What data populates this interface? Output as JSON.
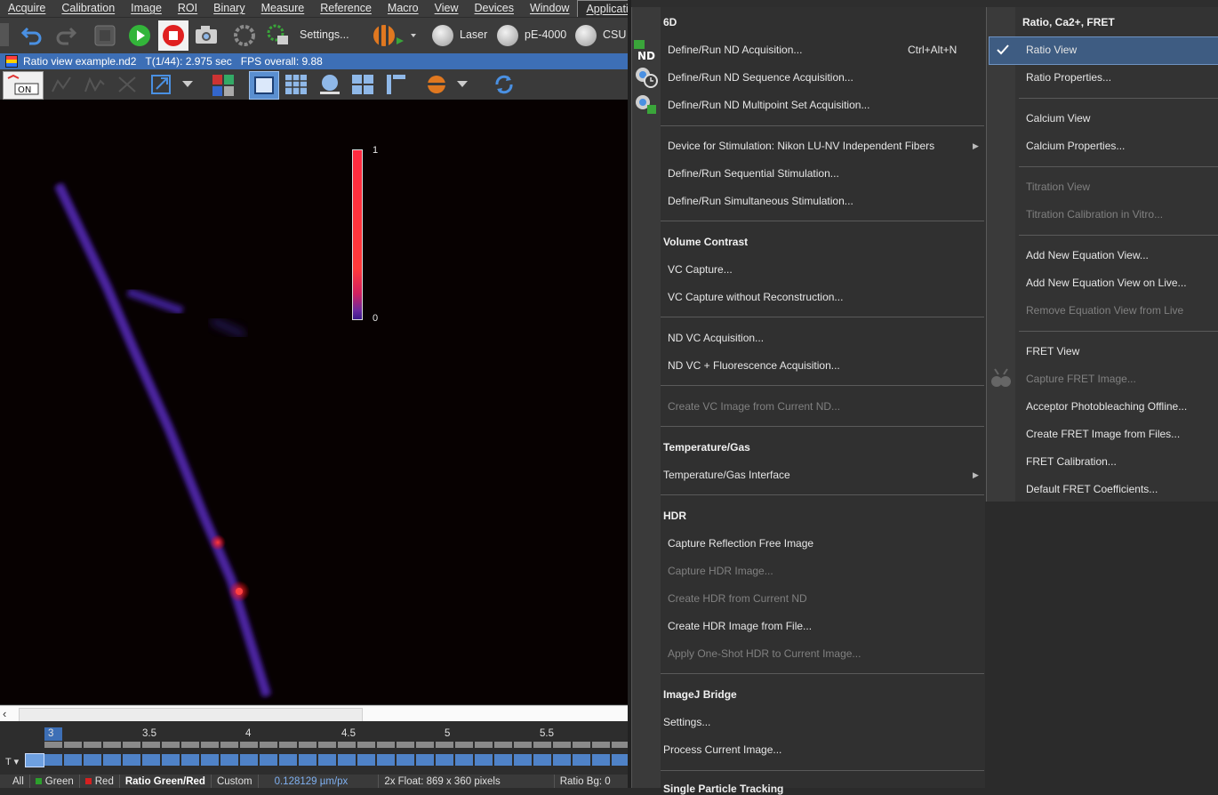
{
  "menubar": {
    "items": [
      "Acquire",
      "Calibration",
      "Image",
      "ROI",
      "Binary",
      "Measure",
      "Reference",
      "Macro",
      "View",
      "Devices",
      "Window",
      "Applications"
    ]
  },
  "toolbar": {
    "settings_label": "Settings...",
    "devices": [
      "Laser",
      "pE-4000",
      "CSU"
    ]
  },
  "image_window": {
    "title": "Ratio view example.nd2",
    "time": "T(1/44): 2.975 sec",
    "fps": "FPS overall: 9.88"
  },
  "scale": {
    "max": "1",
    "min": "0"
  },
  "timeline": {
    "ticks": [
      "3",
      "3.5",
      "4",
      "4.5",
      "5",
      "5.5"
    ],
    "axis_label": "T"
  },
  "statusbar": {
    "all": "All",
    "green": "Green",
    "red": "Red",
    "ratio": "Ratio Green/Red",
    "custom": "Custom",
    "calibration": "0.128129 µm/px",
    "format": "2x Float: 869 x 360 pixels",
    "ratio_bg": "Ratio Bg: 0"
  },
  "apps_menu": {
    "sections": {
      "s6d": "6D",
      "vc": "Volume Contrast",
      "temp": "Temperature/Gas",
      "hdr": "HDR",
      "imagej": "ImageJ Bridge",
      "spt": "Single Particle Tracking"
    },
    "items": {
      "nd_acq": "Define/Run ND Acquisition...",
      "nd_acq_shortcut": "Ctrl+Alt+N",
      "nd_seq": "Define/Run ND Sequence Acquisition...",
      "nd_multi": "Define/Run ND Multipoint Set Acquisition...",
      "stim_device": "Device for Stimulation: Nikon LU-NV Independent Fibers",
      "seq_stim": "Define/Run Sequential Stimulation...",
      "sim_stim": "Define/Run Simultaneous Stimulation...",
      "vc_capture": "VC Capture...",
      "vc_capture_norecon": "VC Capture without Reconstruction...",
      "nd_vc": "ND VC Acquisition...",
      "nd_vc_fluo": "ND VC + Fluorescence Acquisition...",
      "vc_from_nd": "Create VC Image from Current ND...",
      "temp_iface": "Temperature/Gas Interface",
      "refl_free": "Capture Reflection Free Image",
      "cap_hdr": "Capture HDR Image...",
      "hdr_from_nd": "Create HDR from Current ND",
      "hdr_from_file": "Create HDR Image from File...",
      "oneshot_hdr": "Apply One-Shot HDR to Current Image...",
      "ij_settings": "Settings...",
      "ij_process": "Process Current Image..."
    }
  },
  "sub_menu": {
    "header": "Ratio, Ca2+, FRET",
    "items": {
      "ratio_view": "Ratio View",
      "ratio_props": "Ratio Properties...",
      "calcium_view": "Calcium View",
      "calcium_props": "Calcium Properties...",
      "titration_view": "Titration View",
      "titration_calib": "Titration Calibration in Vitro...",
      "add_eq": "Add New Equation View...",
      "add_eq_live": "Add New Equation View on Live...",
      "remove_eq": "Remove Equation View from Live",
      "fret_view": "FRET View",
      "capture_fret": "Capture FRET Image...",
      "acceptor_pb": "Acceptor Photobleaching Offline...",
      "fret_from_files": "Create FRET Image from Files...",
      "fret_calib": "FRET Calibration...",
      "fret_coeffs": "Default FRET Coefficients..."
    }
  },
  "colors": {
    "title_bar": "#3d6fb6",
    "menu_bg": "#303030",
    "highlight": "#3e5c82",
    "play_green": "#33b53a",
    "stop_red": "#e02020"
  }
}
